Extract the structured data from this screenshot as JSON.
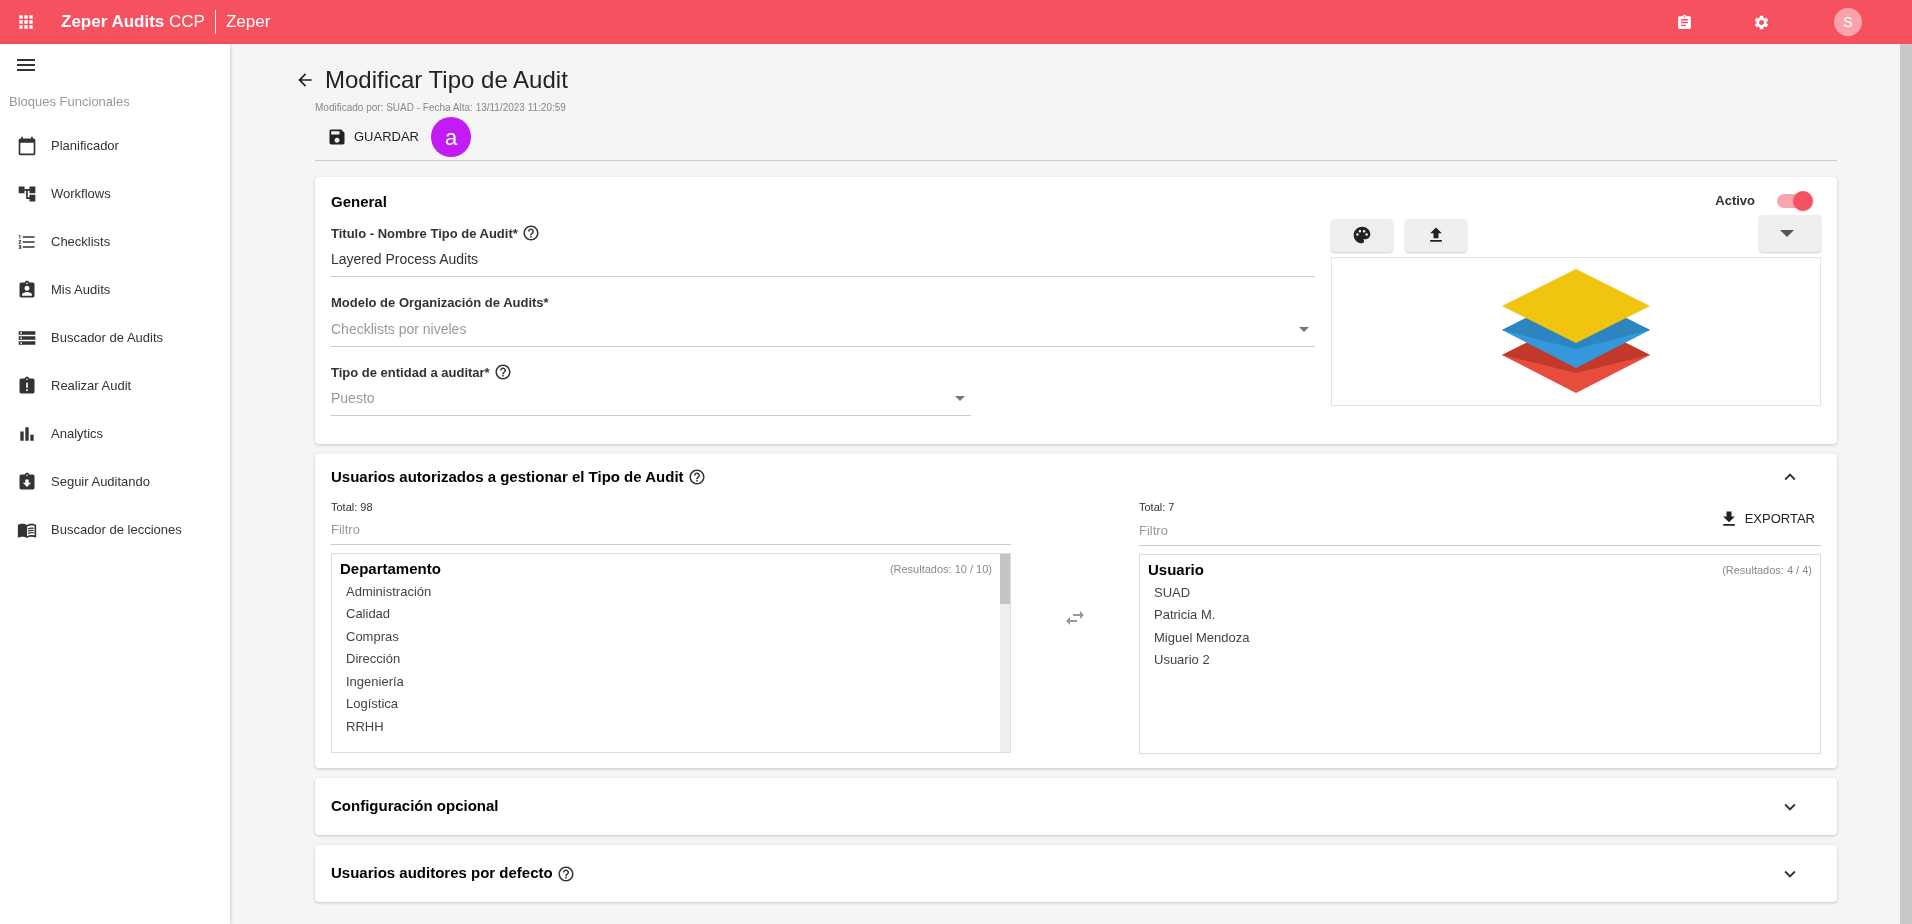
{
  "app_bar": {
    "brand": "Zeper Audits",
    "brand_suffix": "CCP",
    "company": "Zeper",
    "avatar": "S"
  },
  "sidebar": {
    "section": "Bloques Funcionales",
    "items": [
      {
        "label": "Planificador",
        "selected": false
      },
      {
        "label": "Workflows",
        "selected": false
      },
      {
        "label": "Checklists",
        "selected": false
      },
      {
        "label": "Mis Audits",
        "selected": false
      },
      {
        "label": "Buscador de Audits",
        "selected": false
      },
      {
        "label": "Realizar Audit",
        "selected": false
      },
      {
        "label": "Analytics",
        "selected": false
      },
      {
        "label": "Seguir Auditando",
        "selected": false
      },
      {
        "label": "Buscador de lecciones",
        "selected": false
      }
    ]
  },
  "page": {
    "title": "Modificar Tipo de Audit",
    "subtitle": "Modificado por: SUAD - Fecha Alta: 13/11/2023 11:20:59",
    "save_button": "GUARDAR",
    "badge": "a"
  },
  "general": {
    "title": "General",
    "active_label": "Activo",
    "active_on": true,
    "fields": [
      {
        "kind": "text",
        "label": "Titulo - Nombre Tipo de Audit*",
        "help": true,
        "value": "Layered Process Audits",
        "disabled": false
      },
      {
        "kind": "select",
        "label": "Modelo de Organización de Audits*",
        "help": false,
        "value": "Checklists por niveles",
        "disabled": true
      },
      {
        "kind": "select",
        "label": "Tipo de entidad a auditar*",
        "help": true,
        "value": "Puesto",
        "disabled": true
      }
    ]
  },
  "authorized_users": {
    "title": "Usuarios autorizados a gestionar el Tipo de Audit",
    "help": true,
    "expanded": true,
    "left": {
      "total": "Total: 98",
      "filter_placeholder": "Filtro",
      "heading": "Departamento",
      "results": "(Resultados: 10 / 10)",
      "items": [
        "Administración",
        "Calidad",
        "Compras",
        "Dirección",
        "Ingeniería",
        "Logística",
        "RRHH"
      ]
    },
    "right": {
      "total": "Total: 7",
      "filter_placeholder": "Filtro",
      "export_button": "EXPORTAR",
      "heading": "Usuario",
      "results": "(Resultados: 4 / 4)",
      "items": [
        "SUAD",
        "Patricia M.",
        "Miguel Mendoza",
        "Usuario 2"
      ]
    }
  },
  "collapsed_cards": [
    {
      "title": "Configuración opcional",
      "help": false,
      "expanded": false
    },
    {
      "title": "Usuarios auditores por defecto",
      "help": true,
      "expanded": false
    }
  ]
}
